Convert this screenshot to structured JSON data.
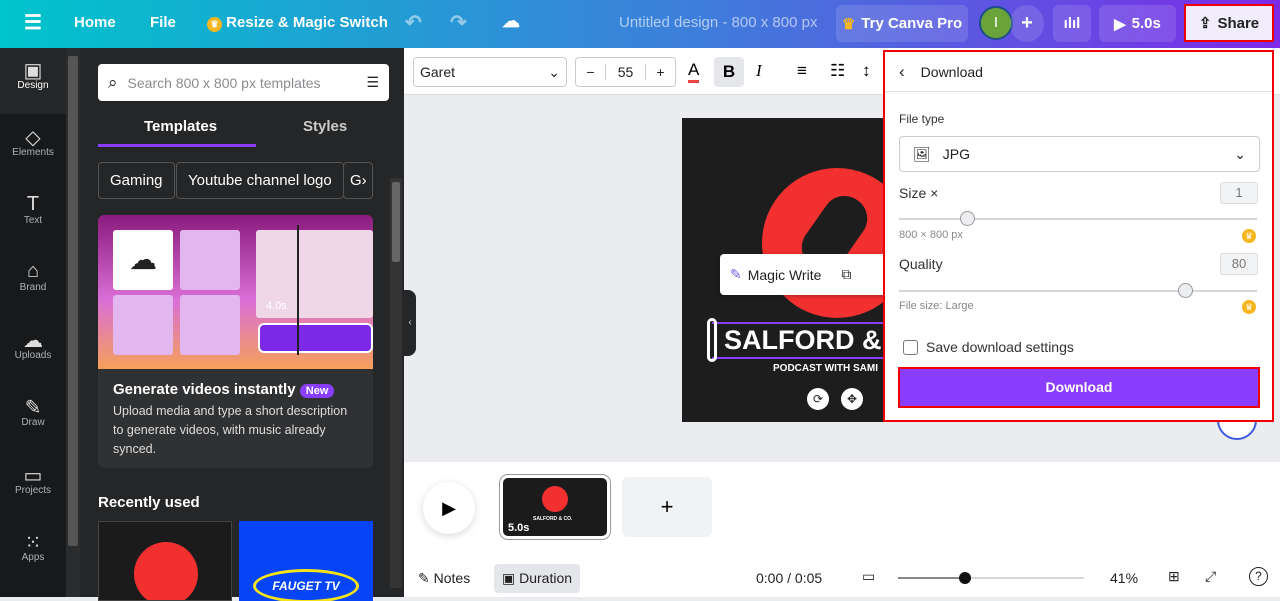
{
  "topbar": {
    "menu_icon": "hamburger-icon",
    "home": "Home",
    "file": "File",
    "resize": "Resize & Magic Switch",
    "title": "Untitled design - 800 x 800 px",
    "try_pro": "Try Canva Pro",
    "avatar_initial": "I",
    "play_duration": "5.0s",
    "share": "Share"
  },
  "rail": [
    {
      "label": "Design",
      "icon": "design-icon"
    },
    {
      "label": "Elements",
      "icon": "elements-icon"
    },
    {
      "label": "Text",
      "icon": "text-icon"
    },
    {
      "label": "Brand",
      "icon": "brand-icon"
    },
    {
      "label": "Uploads",
      "icon": "uploads-icon"
    },
    {
      "label": "Draw",
      "icon": "draw-icon"
    },
    {
      "label": "Projects",
      "icon": "projects-icon"
    },
    {
      "label": "Apps",
      "icon": "apps-icon"
    }
  ],
  "panel": {
    "search_placeholder": "Search 800 x 800 px templates",
    "tabs": [
      "Templates",
      "Styles"
    ],
    "chips": [
      "Gaming",
      "Youtube channel logo",
      "G"
    ],
    "promo": {
      "title": "Generate videos instantly",
      "badge": "New",
      "desc": "Upload media and type a short description to generate videos, with music already synced.",
      "clip_time": "4.0s"
    },
    "recently_used": "Recently used",
    "recent_item_2": "FAUGET TV"
  },
  "toolbar": {
    "font": "Garet",
    "font_size": "55",
    "minus": "−",
    "plus": "+"
  },
  "design": {
    "title": "SALFORD &",
    "subtitle": "PODCAST WITH SAMI",
    "magic_write": "Magic Write"
  },
  "download": {
    "title": "Download",
    "file_type_label": "File type",
    "file_type": "JPG",
    "size_label": "Size ×",
    "size_value": "1",
    "size_slider_fraction": 0.19,
    "dimensions": "800 × 800 px",
    "quality_label": "Quality",
    "quality_value": "80",
    "quality_slider_fraction": 0.8,
    "file_size": "File size: Large",
    "save_settings": "Save download settings",
    "save_settings_checked": false,
    "button": "Download",
    "accent": "#8b3dff"
  },
  "timeline": {
    "page_duration": "5.0s",
    "thumb_text": "SALFORD & CO."
  },
  "bottom": {
    "notes": "Notes",
    "duration": "Duration",
    "time": "0:00 / 0:05",
    "zoom": "41%",
    "zoom_fraction": 0.36
  }
}
